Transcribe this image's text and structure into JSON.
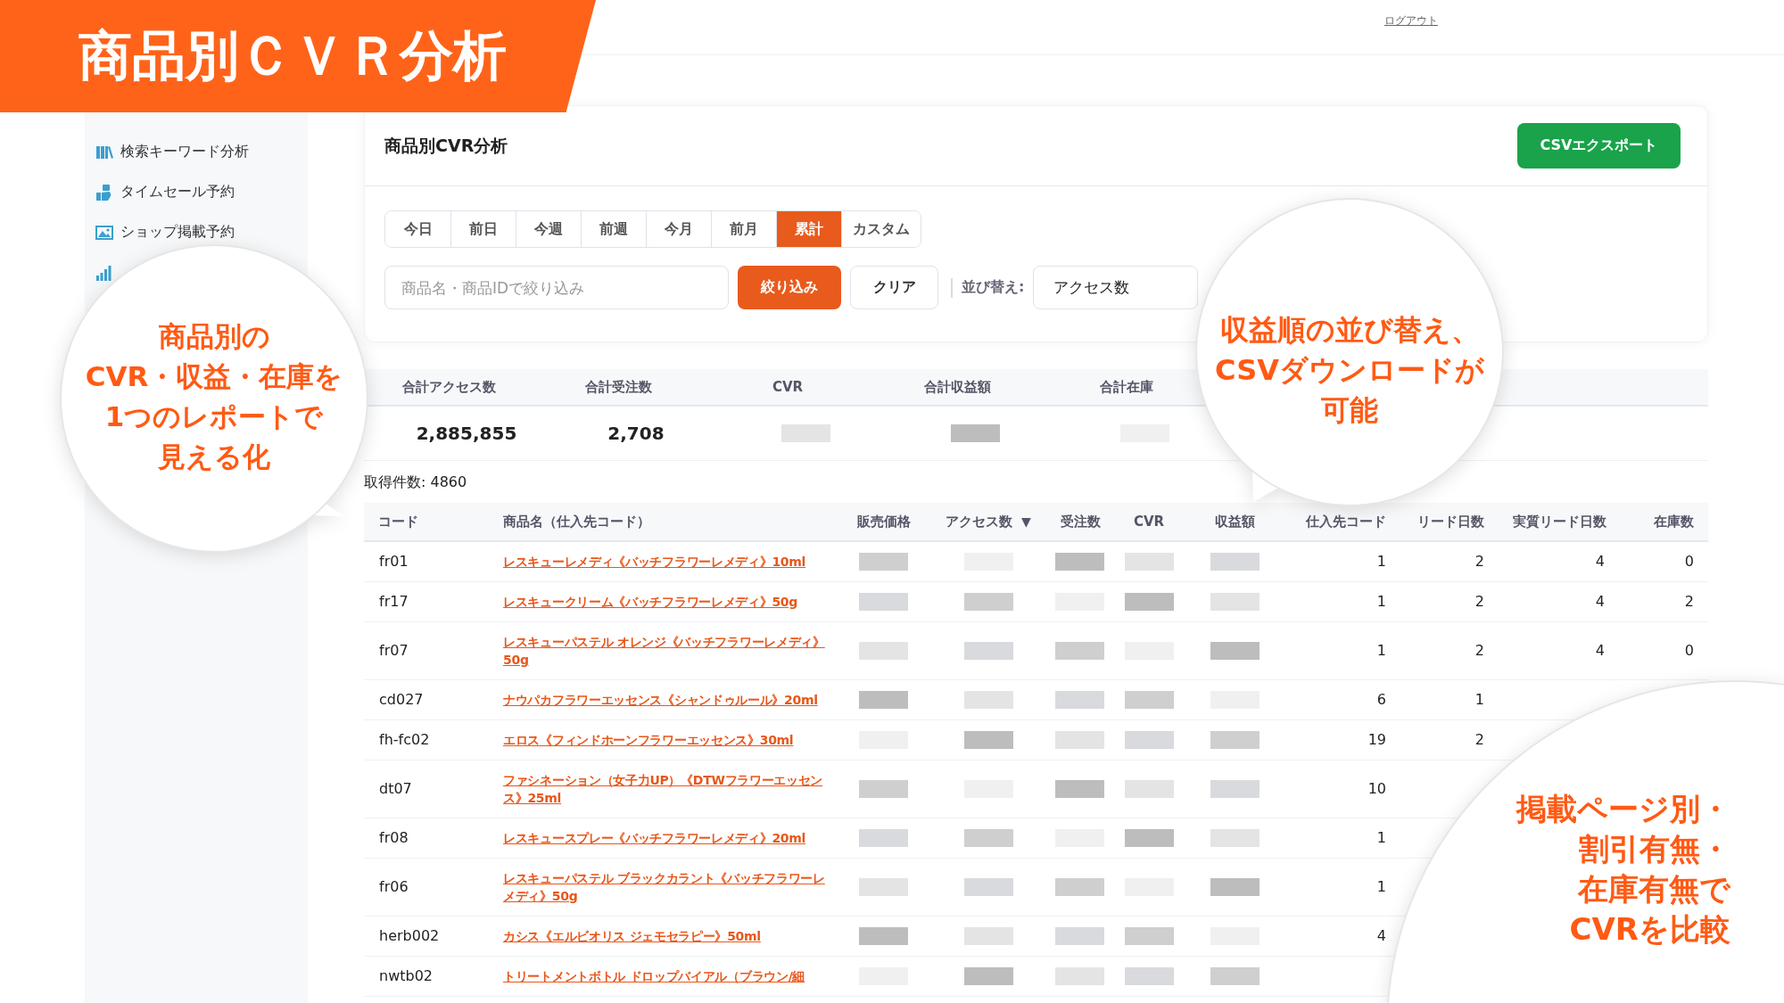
{
  "banner": {
    "title": "商品別ＣＶＲ分析"
  },
  "header": {
    "logout": "ログアウト"
  },
  "sidebar": {
    "items": [
      {
        "kind": "entry",
        "label": "検索キーワード分析"
      },
      {
        "kind": "entry",
        "label": "タイムセール予約"
      },
      {
        "kind": "entry",
        "label": "ショップ掲載予約"
      },
      {
        "kind": "cut"
      }
    ]
  },
  "page": {
    "title": "商品別CVR分析",
    "export_button": "CSVエクスポート"
  },
  "periods": [
    {
      "label": "今日",
      "selected": false
    },
    {
      "label": "前日",
      "selected": false
    },
    {
      "label": "今週",
      "selected": false
    },
    {
      "label": "前週",
      "selected": false
    },
    {
      "label": "今月",
      "selected": false
    },
    {
      "label": "前月",
      "selected": false
    },
    {
      "label": "累計",
      "selected": true
    },
    {
      "label": "カスタム",
      "selected": false
    }
  ],
  "filter": {
    "placeholder": "商品名・商品IDで絞り込み",
    "apply": "絞り込み",
    "clear": "クリア",
    "sort_label": "並び替え:",
    "sort_value": "アクセス数"
  },
  "summary": [
    {
      "label": "合計アクセス数",
      "value": "2,885,855",
      "blurred": false
    },
    {
      "label": "合計受注数",
      "value": "2,708",
      "blurred": false
    },
    {
      "label": "CVR",
      "blurred": true
    },
    {
      "label": "合計収益額",
      "blurred": true
    },
    {
      "label": "合計在庫",
      "blurred": true
    }
  ],
  "result_count": "取得件数: 4860",
  "table": {
    "columns": [
      {
        "label": "コード",
        "kind": "code"
      },
      {
        "label": "商品名（仕入先コード）",
        "kind": "link"
      },
      {
        "label": "販売価格",
        "kind": "blurred"
      },
      {
        "label": "アクセス数",
        "kind": "blurred",
        "sort_mark": "▼"
      },
      {
        "label": "受注数",
        "kind": "blurred"
      },
      {
        "label": "CVR",
        "kind": "blurred"
      },
      {
        "label": "収益額",
        "kind": "blurred"
      },
      {
        "label": "仕入先コード",
        "kind": "number"
      },
      {
        "label": "リード日数",
        "kind": "number"
      },
      {
        "label": "実質リード日数",
        "kind": "number"
      },
      {
        "label": "在庫数",
        "kind": "number"
      }
    ],
    "rows": [
      {
        "code": "fr01",
        "name": "レスキューレメディ《バッチフラワーレメディ》10ml",
        "numbers": [
          "1",
          "2",
          "4",
          "0"
        ]
      },
      {
        "code": "fr17",
        "name": "レスキュークリーム《バッチフラワーレメディ》50g",
        "numbers": [
          "1",
          "2",
          "4",
          "2"
        ]
      },
      {
        "code": "fr07",
        "name": "レスキューパステル オレンジ《バッチフラワーレメディ》50g",
        "numbers": [
          "1",
          "2",
          "4",
          "0"
        ]
      },
      {
        "code": "cd027",
        "name": "ナウパカフラワーエッセンス《シャンドゥルール》20ml",
        "numbers": [
          "6",
          "1"
        ]
      },
      {
        "code": "fh-fc02",
        "name": "エロス《フィンドホーンフラワーエッセンス》30ml",
        "numbers": [
          "19",
          "2"
        ]
      },
      {
        "code": "dt07",
        "name": "ファシネーション（女子力UP）《DTWフラワーエッセンス》25ml",
        "numbers": [
          "10"
        ]
      },
      {
        "code": "fr08",
        "name": "レスキュースプレー《バッチフラワーレメディ》20ml",
        "numbers": [
          "1"
        ]
      },
      {
        "code": "fr06",
        "name": "レスキューパステル ブラックカラント《バッチフラワーレメディ》50g",
        "numbers": [
          "1"
        ]
      },
      {
        "code": "herb002",
        "name": "カシス《エルビオリス ジェモセラピー》50ml",
        "numbers": [
          "4"
        ]
      },
      {
        "code": "nwtb02",
        "name": "トリートメントボトル ドロップバイアル（ブラウン/細",
        "numbers": []
      }
    ]
  },
  "callouts": [
    {
      "lines": [
        "商品別の",
        "CVR・収益・在庫を",
        "1つのレポートで",
        "見える化"
      ]
    },
    {
      "lines": [
        "収益順の並び替え、",
        "CSVダウンロードが",
        "可能"
      ]
    },
    {
      "lines": [
        "掲載ページ別・",
        "割引有無・",
        "在庫有無で",
        "CVRを比較"
      ]
    }
  ]
}
